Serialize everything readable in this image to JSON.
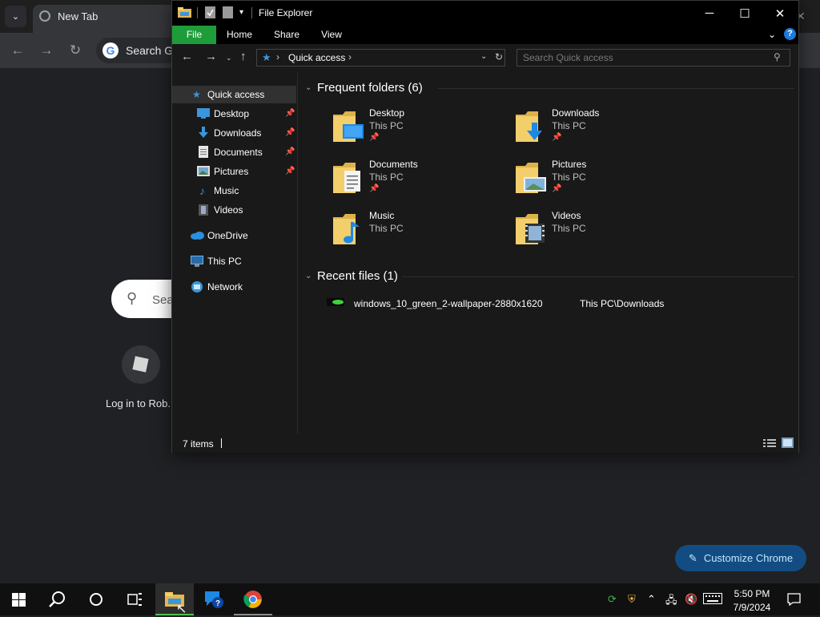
{
  "chrome": {
    "tab_title": "New Tab",
    "tab_close": "✕",
    "omnibox_text": "Search Go",
    "ntp_search_placeholder": "Sea",
    "shortcut_label": "Log in to Rob.",
    "customize_label": "Customize Chrome",
    "colors": {
      "background": "#202124",
      "toolbar": "#35363a",
      "customize_button": "#124c82"
    }
  },
  "explorer": {
    "title": "File Explorer",
    "ribbon_tabs": [
      "File",
      "Home",
      "Share",
      "View"
    ],
    "address": {
      "breadcrumb": "Quick access",
      "separator": "›"
    },
    "search_placeholder": "Search Quick access",
    "nav_pane": {
      "quick_access": "Quick access",
      "pinned": [
        {
          "label": "Desktop",
          "icon": "desktop-icon",
          "pinned": true
        },
        {
          "label": "Downloads",
          "icon": "downloads-icon",
          "pinned": true
        },
        {
          "label": "Documents",
          "icon": "documents-icon",
          "pinned": true
        },
        {
          "label": "Pictures",
          "icon": "pictures-icon",
          "pinned": true
        },
        {
          "label": "Music",
          "icon": "music-icon",
          "pinned": false
        },
        {
          "label": "Videos",
          "icon": "videos-icon",
          "pinned": false
        }
      ],
      "onedrive": "OneDrive",
      "this_pc": "This PC",
      "network": "Network"
    },
    "frequent_header": "Frequent folders (6)",
    "frequent_folders": [
      {
        "name": "Desktop",
        "location": "This PC",
        "pinned": true,
        "icon": "desktop-folder-icon"
      },
      {
        "name": "Downloads",
        "location": "This PC",
        "pinned": true,
        "icon": "downloads-folder-icon"
      },
      {
        "name": "Documents",
        "location": "This PC",
        "pinned": true,
        "icon": "documents-folder-icon"
      },
      {
        "name": "Pictures",
        "location": "This PC",
        "pinned": true,
        "icon": "pictures-folder-icon"
      },
      {
        "name": "Music",
        "location": "This PC",
        "pinned": false,
        "icon": "music-folder-icon"
      },
      {
        "name": "Videos",
        "location": "This PC",
        "pinned": false,
        "icon": "videos-folder-icon"
      }
    ],
    "recent_header": "Recent files (1)",
    "recent_files": [
      {
        "name": "windows_10_green_2-wallpaper-2880x1620",
        "path": "This PC\\Downloads"
      }
    ],
    "status": "7 items",
    "colors": {
      "file_tab": "#1e9c3a",
      "accent": "#3a96dd",
      "window_bg": "#191919"
    }
  },
  "taskbar": {
    "time": "5:50 PM",
    "date": "7/9/2024"
  }
}
